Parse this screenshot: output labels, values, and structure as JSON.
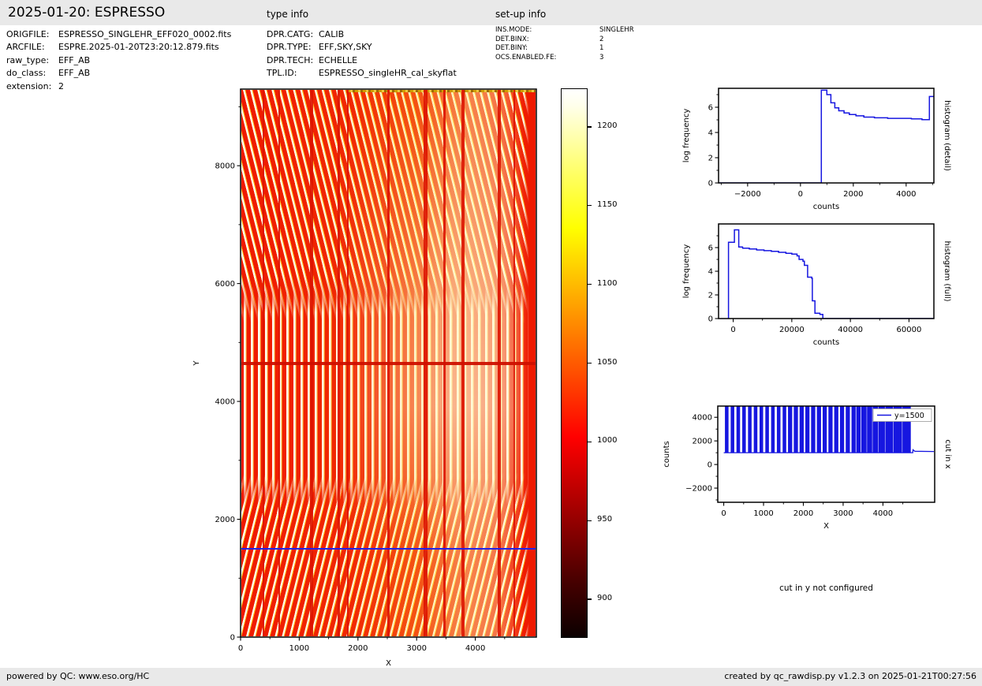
{
  "header": {
    "title": "2025-01-20: ESPRESSO"
  },
  "file_info": {
    "rows": [
      {
        "label": "ORIGFILE:",
        "value": "ESPRESSO_SINGLEHR_EFF020_0002.fits"
      },
      {
        "label": "ARCFILE:",
        "value": "ESPRE.2025-01-20T23:20:12.879.fits"
      },
      {
        "label": "raw_type:",
        "value": "EFF_AB"
      },
      {
        "label": "do_class:",
        "value": "EFF_AB"
      },
      {
        "label": "extension:",
        "value": "2"
      }
    ]
  },
  "type_info": {
    "title": "type info",
    "rows": [
      {
        "label": "DPR.CATG:",
        "value": "CALIB"
      },
      {
        "label": "DPR.TYPE:",
        "value": "EFF,SKY,SKY"
      },
      {
        "label": "DPR.TECH:",
        "value": "ECHELLE"
      },
      {
        "label": "TPL.ID:",
        "value": "ESPRESSO_singleHR_cal_skyflat"
      }
    ]
  },
  "setup_info": {
    "title": "set-up info",
    "rows": [
      {
        "label": "INS.MODE:",
        "value": "SINGLEHR"
      },
      {
        "label": "DET.BINX:",
        "value": "2"
      },
      {
        "label": "DET.BINY:",
        "value": "1"
      },
      {
        "label": "OCS.ENABLED.FE:",
        "value": "3"
      }
    ]
  },
  "footer": {
    "left": "powered by QC: www.eso.org/HC",
    "right": "created by qc_rawdisp.py v1.2.3 on 2025-01-21T00:27:56"
  },
  "cut_in_y_message": "cut in y not configured",
  "colors": {
    "line_blue": "#1616e0",
    "image_red": "#ef1a00",
    "band_gray": "#e9e9e9"
  },
  "chart_data": [
    {
      "key": "main",
      "type": "heatmap",
      "xlabel": "X",
      "ylabel": "Y",
      "xlim": [
        0,
        5040
      ],
      "ylim": [
        0,
        9300
      ],
      "xticks": [
        0,
        1000,
        2000,
        3000,
        4000
      ],
      "yticks": [
        0,
        2000,
        4000,
        6000,
        8000
      ],
      "ylabel_off": 53,
      "xlabel_off": 36,
      "overlays": {
        "cut_line_y": 1500,
        "dark_row_y": 4650,
        "dark_columns": [
          [
            360,
            2
          ],
          [
            630,
            2
          ],
          [
            1180,
            4
          ],
          [
            1650,
            3
          ],
          [
            1815,
            2
          ],
          [
            2500,
            3
          ],
          [
            3120,
            5
          ],
          [
            3455,
            3
          ],
          [
            3765,
            4
          ],
          [
            4395,
            4
          ],
          [
            4665,
            2
          ]
        ]
      }
    },
    {
      "key": "colorbar",
      "type": "colorbar",
      "ticks": [
        900,
        950,
        1000,
        1050,
        1100,
        1150,
        1200
      ],
      "vmin": 876,
      "vmax": 1224,
      "colormap": "hot"
    },
    {
      "key": "hist_detail",
      "type": "line",
      "xlabel": "counts",
      "ylabel": "log frequency",
      "right_label": "histogram (detail)",
      "xlim": [
        -3100,
        5050
      ],
      "ylim": [
        0,
        7.5
      ],
      "xticks": [
        -2000,
        0,
        2000,
        4000
      ],
      "yticks": [
        0,
        2,
        4,
        6
      ],
      "ylabel_off": 38,
      "xlabel_off": 33,
      "points": [
        [
          -3100,
          0
        ],
        [
          790,
          0
        ],
        [
          790,
          7.35
        ],
        [
          1000,
          7.35
        ],
        [
          1000,
          7.0
        ],
        [
          1150,
          7.0
        ],
        [
          1150,
          6.35
        ],
        [
          1300,
          6.35
        ],
        [
          1300,
          5.95
        ],
        [
          1450,
          5.95
        ],
        [
          1450,
          5.72
        ],
        [
          1650,
          5.72
        ],
        [
          1650,
          5.55
        ],
        [
          1850,
          5.55
        ],
        [
          1850,
          5.42
        ],
        [
          2100,
          5.42
        ],
        [
          2100,
          5.32
        ],
        [
          2400,
          5.32
        ],
        [
          2400,
          5.22
        ],
        [
          2800,
          5.22
        ],
        [
          2800,
          5.16
        ],
        [
          3300,
          5.16
        ],
        [
          3300,
          5.12
        ],
        [
          4200,
          5.12
        ],
        [
          4200,
          5.08
        ],
        [
          4600,
          5.08
        ],
        [
          4600,
          5.02
        ],
        [
          4880,
          5.02
        ],
        [
          4880,
          6.85
        ],
        [
          5050,
          6.85
        ]
      ]
    },
    {
      "key": "hist_full",
      "type": "line",
      "xlabel": "counts",
      "ylabel": "log frequency",
      "right_label": "histogram (full)",
      "xlim": [
        -5000,
        68500
      ],
      "ylim": [
        0,
        8
      ],
      "xticks": [
        0,
        20000,
        40000,
        60000
      ],
      "yticks": [
        0,
        2,
        4,
        6
      ],
      "ylabel_off": 38,
      "xlabel_off": 33,
      "points": [
        [
          -1600,
          0
        ],
        [
          -1600,
          6.45
        ],
        [
          400,
          6.45
        ],
        [
          400,
          7.5
        ],
        [
          1900,
          7.5
        ],
        [
          1900,
          6.05
        ],
        [
          3200,
          6.05
        ],
        [
          3200,
          5.95
        ],
        [
          5500,
          5.95
        ],
        [
          5500,
          5.88
        ],
        [
          8000,
          5.88
        ],
        [
          8000,
          5.8
        ],
        [
          10500,
          5.8
        ],
        [
          10500,
          5.74
        ],
        [
          13000,
          5.74
        ],
        [
          13000,
          5.68
        ],
        [
          15500,
          5.68
        ],
        [
          15500,
          5.6
        ],
        [
          18000,
          5.6
        ],
        [
          18000,
          5.52
        ],
        [
          20000,
          5.52
        ],
        [
          20000,
          5.45
        ],
        [
          21800,
          5.45
        ],
        [
          21800,
          5.3
        ],
        [
          22500,
          5.3
        ],
        [
          22500,
          5.0
        ],
        [
          23800,
          5.0
        ],
        [
          23800,
          4.85
        ],
        [
          24300,
          4.85
        ],
        [
          24300,
          4.5
        ],
        [
          25400,
          4.5
        ],
        [
          25400,
          3.5
        ],
        [
          26800,
          3.5
        ],
        [
          26800,
          3.4
        ],
        [
          27000,
          3.4
        ],
        [
          27000,
          1.5
        ],
        [
          27900,
          1.5
        ],
        [
          27900,
          0.45
        ],
        [
          29600,
          0.45
        ],
        [
          29600,
          0.35
        ],
        [
          30600,
          0.35
        ],
        [
          30600,
          0
        ],
        [
          68500,
          0
        ]
      ]
    },
    {
      "key": "cut_x",
      "type": "bars",
      "xlabel": "X",
      "ylabel": "counts",
      "right_label": "cut in x",
      "legend": "y=1500",
      "xlim": [
        -150,
        5300
      ],
      "ylim": [
        -3200,
        4950
      ],
      "xticks": [
        0,
        1000,
        2000,
        3000,
        4000
      ],
      "yticks": [
        -2000,
        0,
        2000,
        4000
      ],
      "ylabel_off": 62,
      "xlabel_off": 33,
      "bar_base": 1000,
      "bar_top": 4950,
      "bars": [
        [
          30,
          120
        ],
        [
          175,
          265
        ],
        [
          320,
          410
        ],
        [
          465,
          555
        ],
        [
          610,
          700
        ],
        [
          755,
          845
        ],
        [
          900,
          990
        ],
        [
          1045,
          1135
        ],
        [
          1190,
          1280
        ],
        [
          1335,
          1425
        ],
        [
          1480,
          1570
        ],
        [
          1615,
          1720
        ],
        [
          1760,
          1865
        ],
        [
          1905,
          2010
        ],
        [
          2050,
          2155
        ],
        [
          2195,
          2300
        ],
        [
          2340,
          2445
        ],
        [
          2485,
          2590
        ],
        [
          2630,
          2735
        ],
        [
          2775,
          2880
        ],
        [
          2920,
          3025
        ],
        [
          3065,
          3170
        ],
        [
          3210,
          3315
        ],
        [
          3330,
          3440
        ],
        [
          3455,
          3590
        ],
        [
          3600,
          3730
        ],
        [
          3740,
          3880
        ],
        [
          3890,
          4050
        ],
        [
          4060,
          4250
        ],
        [
          4260,
          4480
        ],
        [
          4490,
          4700
        ]
      ],
      "baseline": [
        [
          0,
          1000
        ],
        [
          4750,
          1000
        ],
        [
          4755,
          1250
        ],
        [
          4800,
          1120
        ],
        [
          5280,
          1100
        ]
      ]
    }
  ]
}
